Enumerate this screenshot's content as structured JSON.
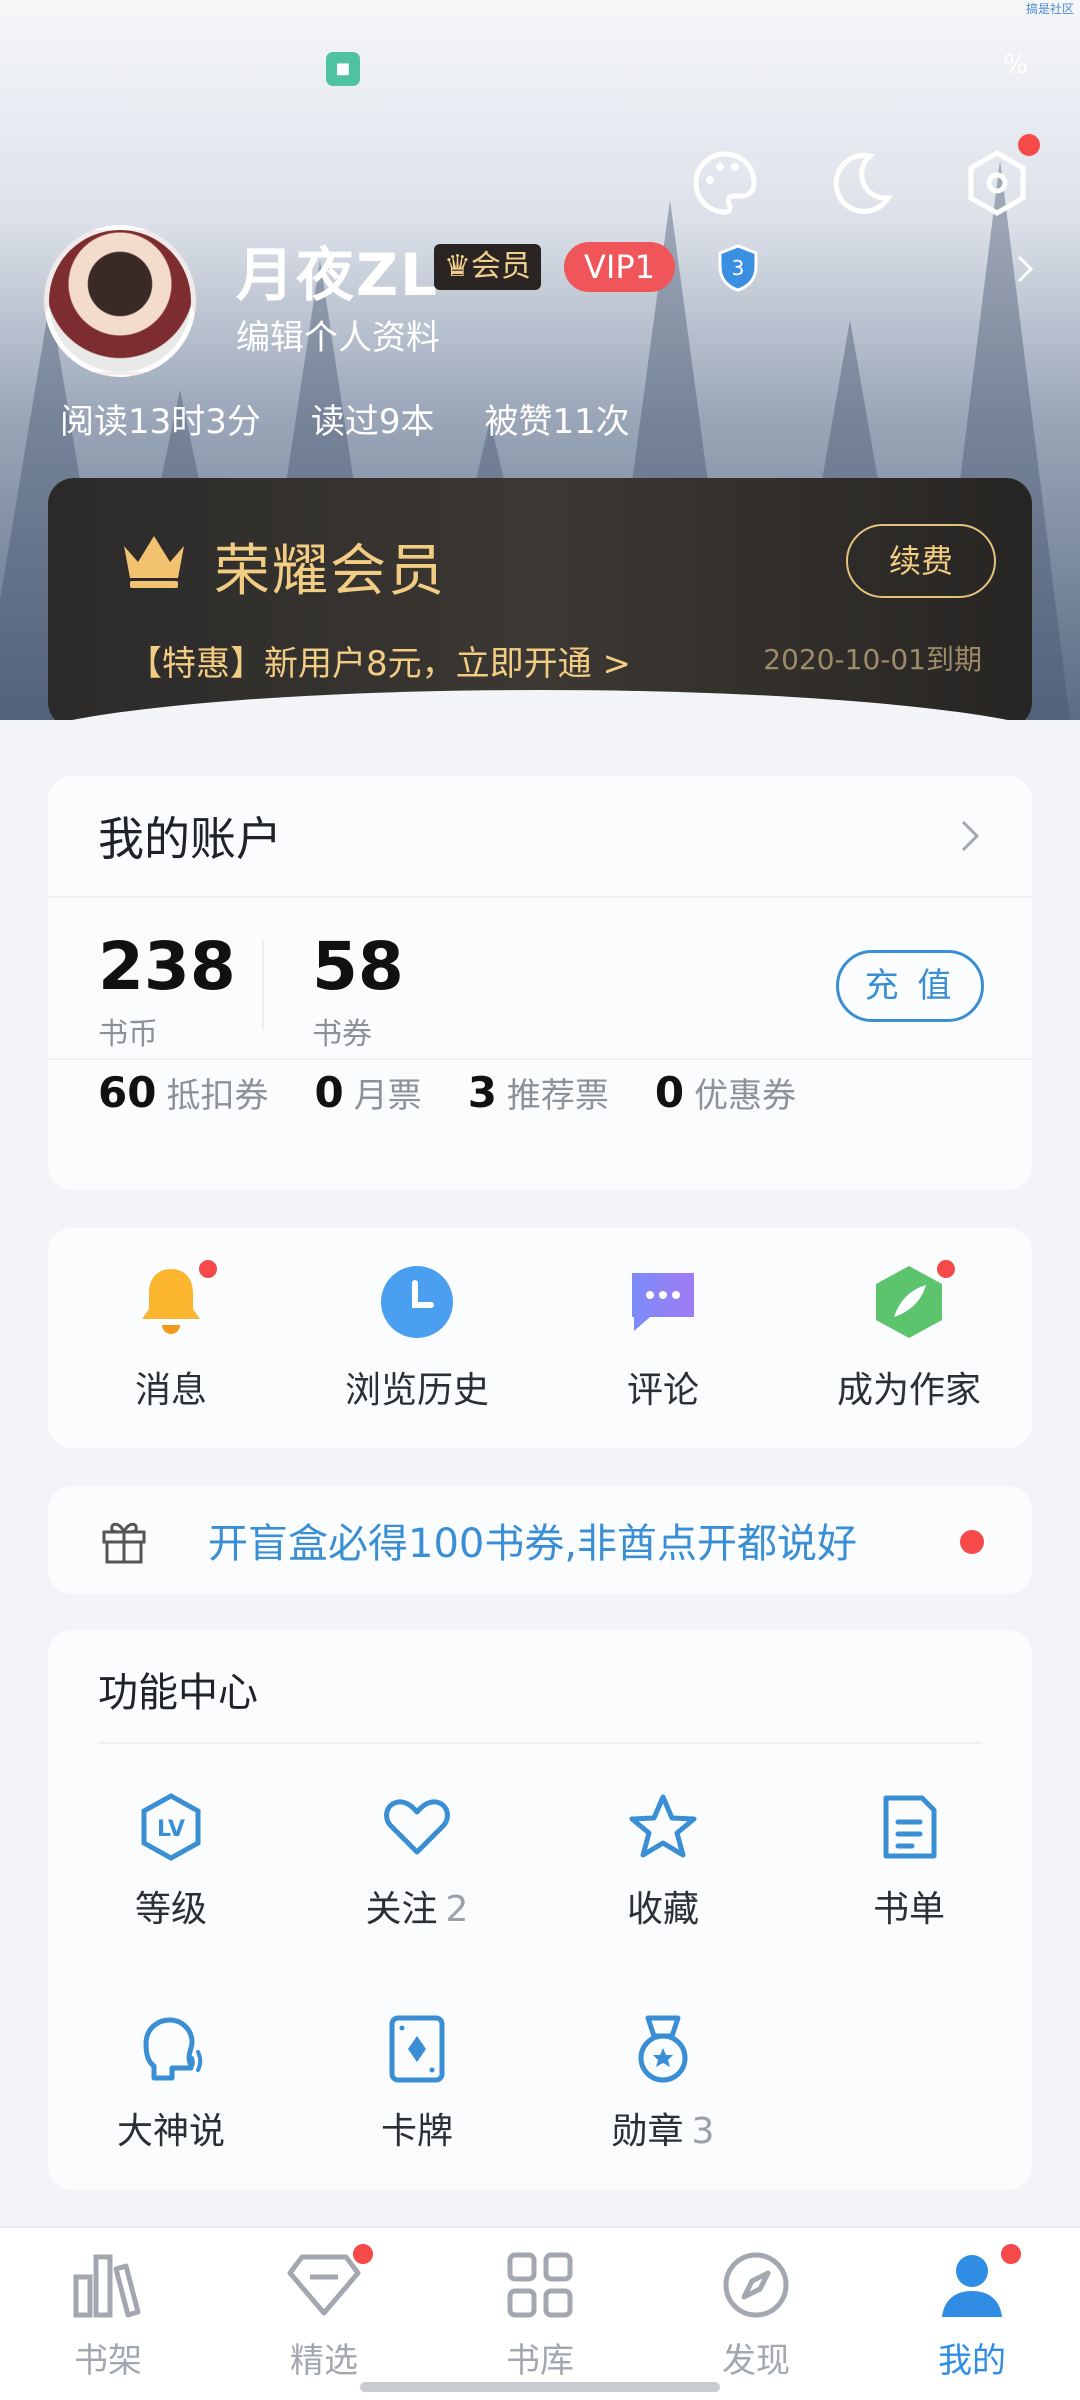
{
  "status_bar": {
    "battery": "%",
    "watermark": "搞是社区"
  },
  "profile": {
    "name": "月夜ZL",
    "member_tag": "会员",
    "vip_level": "VIP1",
    "shield_level": "3",
    "edit": "编辑个人资料",
    "stats": [
      "阅读13时3分",
      "读过9本",
      "被赞11次"
    ]
  },
  "vip_card": {
    "title": "荣耀会员",
    "renew": "续费",
    "promo": "【特惠】新用户8元，立即开通 >",
    "expire": "2020-10-01到期"
  },
  "account": {
    "title": "我的账户",
    "coins_value": "238",
    "coins_label": "书币",
    "vouchers_value": "58",
    "vouchers_label": "书券",
    "charge": "充 值",
    "tickets": [
      {
        "value": "60",
        "label": "抵扣券"
      },
      {
        "value": "0",
        "label": "月票"
      },
      {
        "value": "3",
        "label": "推荐票"
      },
      {
        "value": "0",
        "label": "优惠券"
      }
    ]
  },
  "quick": [
    {
      "label": "消息",
      "icon": "bell-icon"
    },
    {
      "label": "浏览历史",
      "icon": "clock-icon"
    },
    {
      "label": "评论",
      "icon": "comment-icon"
    },
    {
      "label": "成为作家",
      "icon": "quill-icon"
    }
  ],
  "banner": {
    "text": "开盲盒必得100书券,非酋点开都说好",
    "icon": "gift-icon"
  },
  "functions": {
    "title": "功能中心",
    "items": [
      {
        "label": "等级",
        "count": "",
        "icon": "level-icon"
      },
      {
        "label": "关注",
        "count": "2",
        "icon": "heart-icon"
      },
      {
        "label": "收藏",
        "count": "",
        "icon": "star-icon"
      },
      {
        "label": "书单",
        "count": "",
        "icon": "booklist-icon"
      },
      {
        "label": "大神说",
        "count": "",
        "icon": "speaker-icon"
      },
      {
        "label": "卡牌",
        "count": "",
        "icon": "card-icon"
      },
      {
        "label": "勋章",
        "count": "3",
        "icon": "medal-icon"
      }
    ]
  },
  "tabs": [
    {
      "label": "书架",
      "icon": "bookshelf-icon"
    },
    {
      "label": "精选",
      "icon": "diamond-icon"
    },
    {
      "label": "书库",
      "icon": "grid-icon"
    },
    {
      "label": "发现",
      "icon": "compass-icon"
    },
    {
      "label": "我的",
      "icon": "person-icon"
    }
  ],
  "colors": {
    "accent": "#3a8fd4",
    "vip_gold": "#f2cc82",
    "badge_red": "#f5494a"
  }
}
